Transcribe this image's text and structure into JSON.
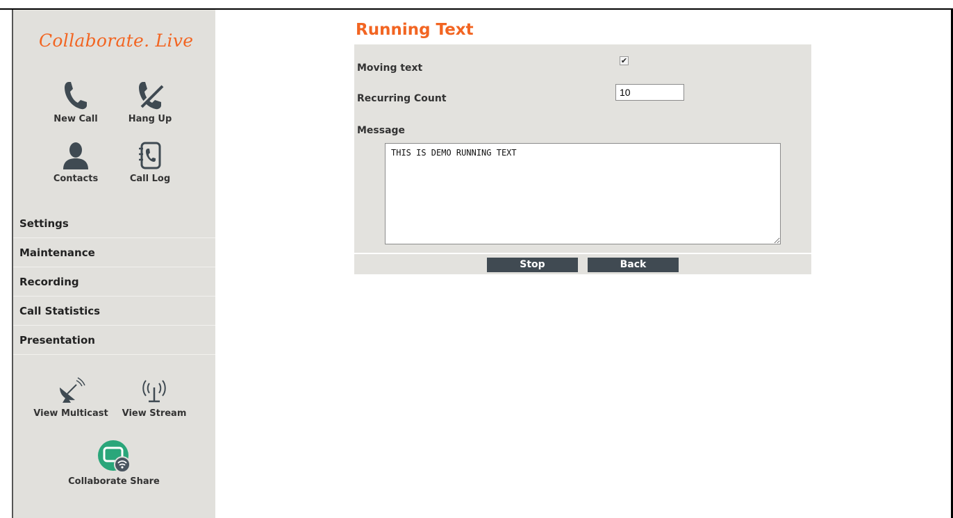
{
  "brand": {
    "logo_text": "Collaborate. Live"
  },
  "sidebar": {
    "tiles": [
      {
        "label": "New Call",
        "icon": "phone-icon"
      },
      {
        "label": "Hang Up",
        "icon": "hang-up-icon"
      },
      {
        "label": "Contacts",
        "icon": "contact-person-icon"
      },
      {
        "label": "Call Log",
        "icon": "call-log-icon"
      }
    ],
    "menu": [
      "Settings",
      "Maintenance",
      "Recording",
      "Call Statistics",
      "Presentation"
    ],
    "bottom_tiles": [
      {
        "label": "View Multicast",
        "icon": "satellite-dish-icon"
      },
      {
        "label": "View Stream",
        "icon": "antenna-icon"
      },
      {
        "label": "Collaborate Share",
        "icon": "wireless-share-icon"
      }
    ]
  },
  "main": {
    "title": "Running Text",
    "moving_text_label": "Moving text",
    "moving_text_checked": true,
    "recurring_count_label": "Recurring Count",
    "recurring_count_value": "10",
    "message_label": "Message",
    "message_value": "THIS IS DEMO RUNNING TEXT",
    "buttons": {
      "stop": "Stop",
      "back": "Back"
    }
  },
  "colors": {
    "accent": "#f26522",
    "sidebar_bg": "#e1e0dc",
    "panel_bg": "#e3e2de",
    "button_bg": "#404a52",
    "icon": "#3f4a52",
    "share_green": "#2aa67a"
  }
}
